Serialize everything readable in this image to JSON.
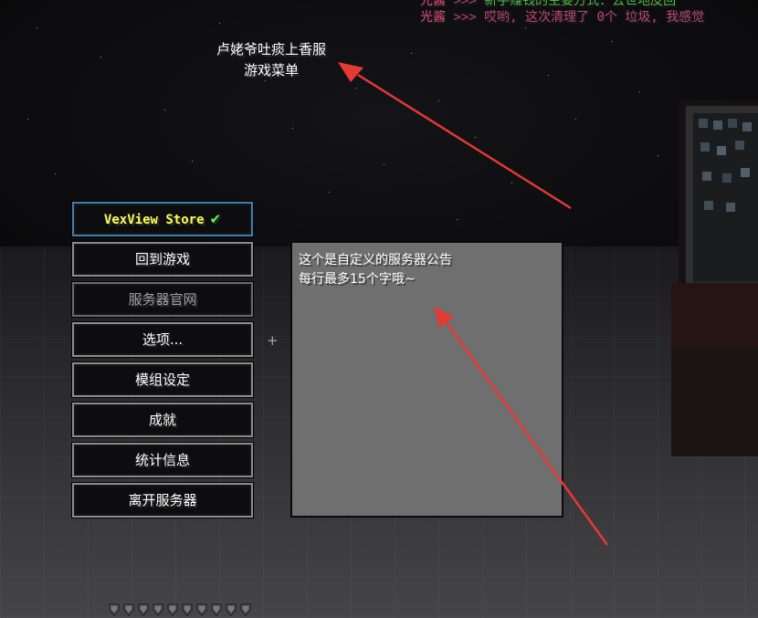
{
  "chat": {
    "line1": {
      "name": "光酱",
      "sep": ">>>",
      "text": "新手赚钱的主要方式：去世地皮回"
    },
    "line2": {
      "name": "光酱",
      "sep": ">>>",
      "text": "哎哟, 这次清理了 0个 垃圾, 我感觉"
    }
  },
  "title": {
    "line1": "卢姥爷吐痰上香服",
    "line2": "游戏菜单"
  },
  "menu": {
    "store_label": "VexView Store",
    "store_check": "✔",
    "back_to_game": "回到游戏",
    "server_website": "服务器官网",
    "options": "选项...",
    "mod_settings": "模组设定",
    "achievements": "成就",
    "statistics": "统计信息",
    "leave_server": "离开服务器"
  },
  "notice": {
    "line1": "这个是自定义的服务器公告",
    "line2": "每行最多15个字哦~"
  },
  "crosshair": "+",
  "hotbar": {
    "armor_icon": "armor-icon",
    "count": 10
  },
  "colors": {
    "store_border": "#3f7fb2",
    "store_text": "#ffff55",
    "check": "#55ff55",
    "notice_bg": "#6f6f6f",
    "arrow": "#e53935"
  }
}
